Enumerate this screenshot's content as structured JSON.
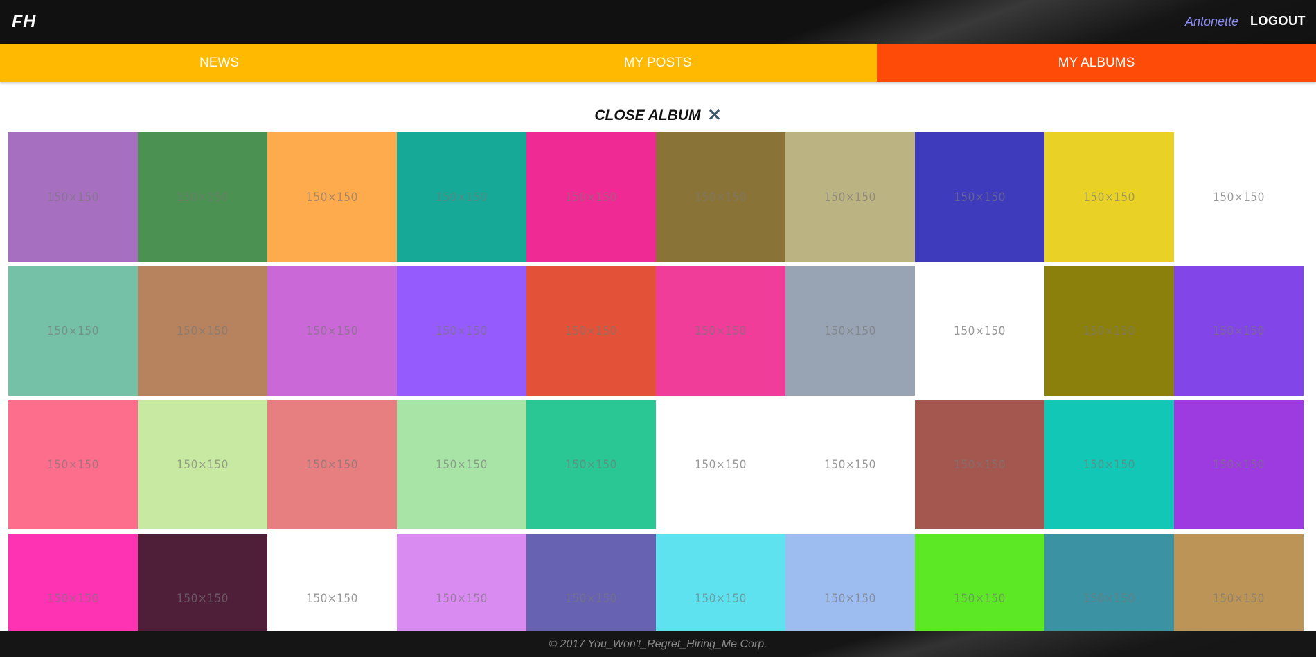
{
  "header": {
    "logo": "FH",
    "username": "Antonette",
    "logout_label": "LOGOUT"
  },
  "tabs": [
    {
      "label": "NEWS",
      "active": false
    },
    {
      "label": "MY POSTS",
      "active": false
    },
    {
      "label": "MY ALBUMS",
      "active": true
    }
  ],
  "album": {
    "close_label": "CLOSE ALBUM",
    "close_icon": "close-icon",
    "photo_label": "150×150",
    "photos": [
      {
        "color": "#a66fc0"
      },
      {
        "color": "#4b9151"
      },
      {
        "color": "#feab4e"
      },
      {
        "color": "#17a997"
      },
      {
        "color": "#f02a94"
      },
      {
        "color": "#8a7337"
      },
      {
        "color": "#bbb381"
      },
      {
        "color": "#3f3bbd"
      },
      {
        "color": "#ead125"
      },
      {
        "color": "#ffffff"
      },
      {
        "color": "#74c1a8"
      },
      {
        "color": "#b6835e"
      },
      {
        "color": "#c968d6"
      },
      {
        "color": "#955bfd"
      },
      {
        "color": "#e25138"
      },
      {
        "color": "#ef3d99"
      },
      {
        "color": "#98a4b3"
      },
      {
        "color": "#ffffff"
      },
      {
        "color": "#8c800c"
      },
      {
        "color": "#8245e8"
      },
      {
        "color": "#fd6e8d"
      },
      {
        "color": "#c8e9a1"
      },
      {
        "color": "#e77e80"
      },
      {
        "color": "#a9e4a7"
      },
      {
        "color": "#2ac694"
      },
      {
        "color": "#ffffff"
      },
      {
        "color": "#ffffff"
      },
      {
        "color": "#a3574f"
      },
      {
        "color": "#12c7b5"
      },
      {
        "color": "#9d3be1"
      },
      {
        "color": "#fd33b4"
      },
      {
        "color": "#4f1f3a"
      },
      {
        "color": "#ffffff"
      },
      {
        "color": "#da8bf1"
      },
      {
        "color": "#6762b2"
      },
      {
        "color": "#5ee2ef"
      },
      {
        "color": "#9dbcf0"
      },
      {
        "color": "#5ce824"
      },
      {
        "color": "#3a92a2"
      },
      {
        "color": "#bd9458"
      }
    ]
  },
  "footer": {
    "text": "© 2017 You_Won't_Regret_Hiring_Me Corp."
  }
}
